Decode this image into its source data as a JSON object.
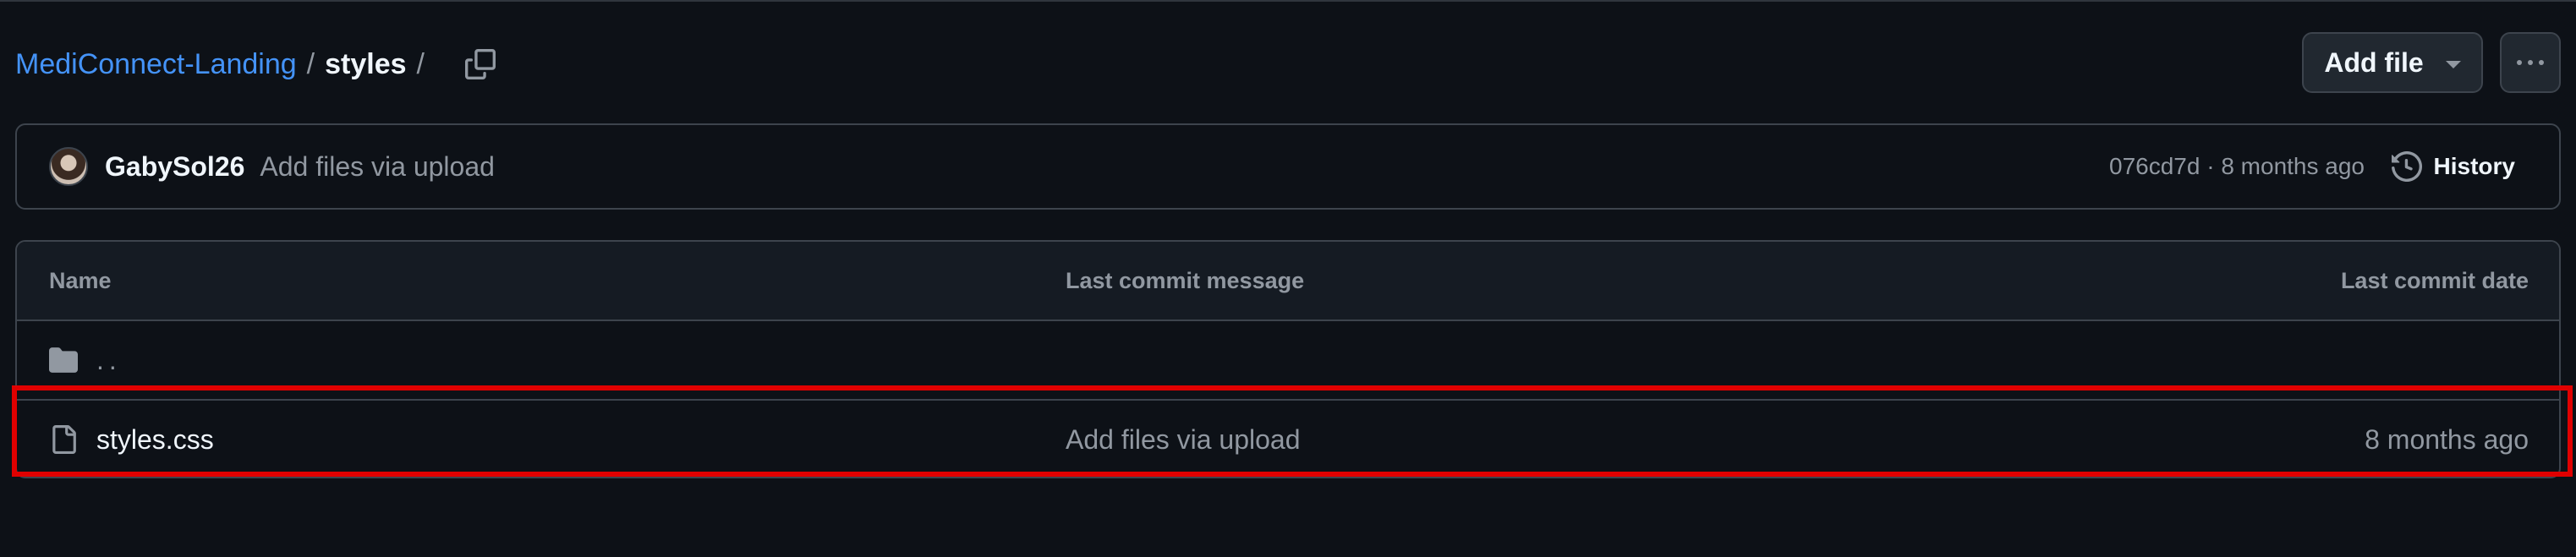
{
  "breadcrumb": {
    "repo": "MediConnect-Landing",
    "separator": "/",
    "folder": "styles",
    "trailing_separator": "/"
  },
  "header": {
    "add_file_label": "Add file",
    "icons": {
      "copy": "copy-path-icon",
      "dropdown": "triangle-down-icon",
      "more": "kebab-horizontal-icon"
    }
  },
  "commit": {
    "author": "GabySol26",
    "message": "Add files via upload",
    "sha": "076cd7d",
    "meta_separator": "·",
    "time": "8 months ago",
    "history_label": "History"
  },
  "table": {
    "columns": [
      "Name",
      "Last commit message",
      "Last commit date"
    ],
    "parent_dir": "..",
    "rows": [
      {
        "name": "styles.css",
        "type": "file",
        "message": "Add files via upload",
        "date": "8 months ago"
      }
    ]
  },
  "colors": {
    "background": "#0d1117",
    "link": "#4493f8",
    "muted": "#9198a1",
    "border": "#3d444d",
    "highlight": "#e00000"
  }
}
